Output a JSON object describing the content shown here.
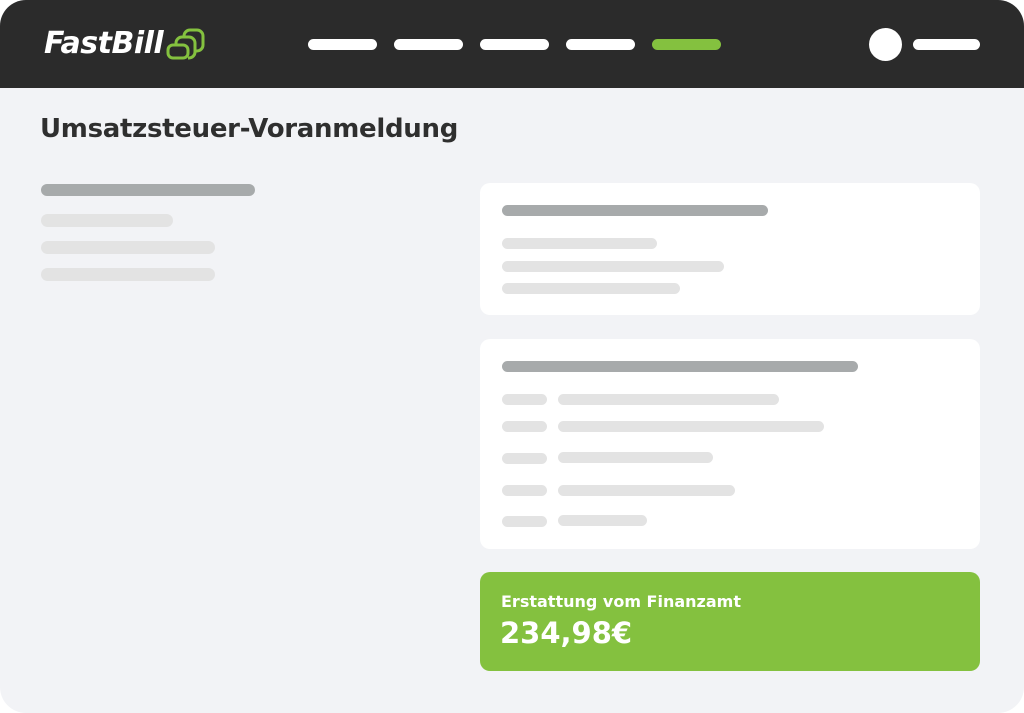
{
  "app": {
    "brand": "FastBill",
    "accent_color": "#84c13f",
    "topbar_color": "#2b2b2b"
  },
  "header": {
    "logo_icon": "signal-wave-icon",
    "nav_items": [
      {
        "active": false
      },
      {
        "active": false
      },
      {
        "active": false
      },
      {
        "active": false
      },
      {
        "active": true
      }
    ],
    "user_icon": "avatar-icon"
  },
  "main": {
    "title": "Umsatzsteuer-Voranmeldung"
  },
  "refund": {
    "label": "Erstattung vom Finanzamt",
    "amount": "234,98€"
  }
}
